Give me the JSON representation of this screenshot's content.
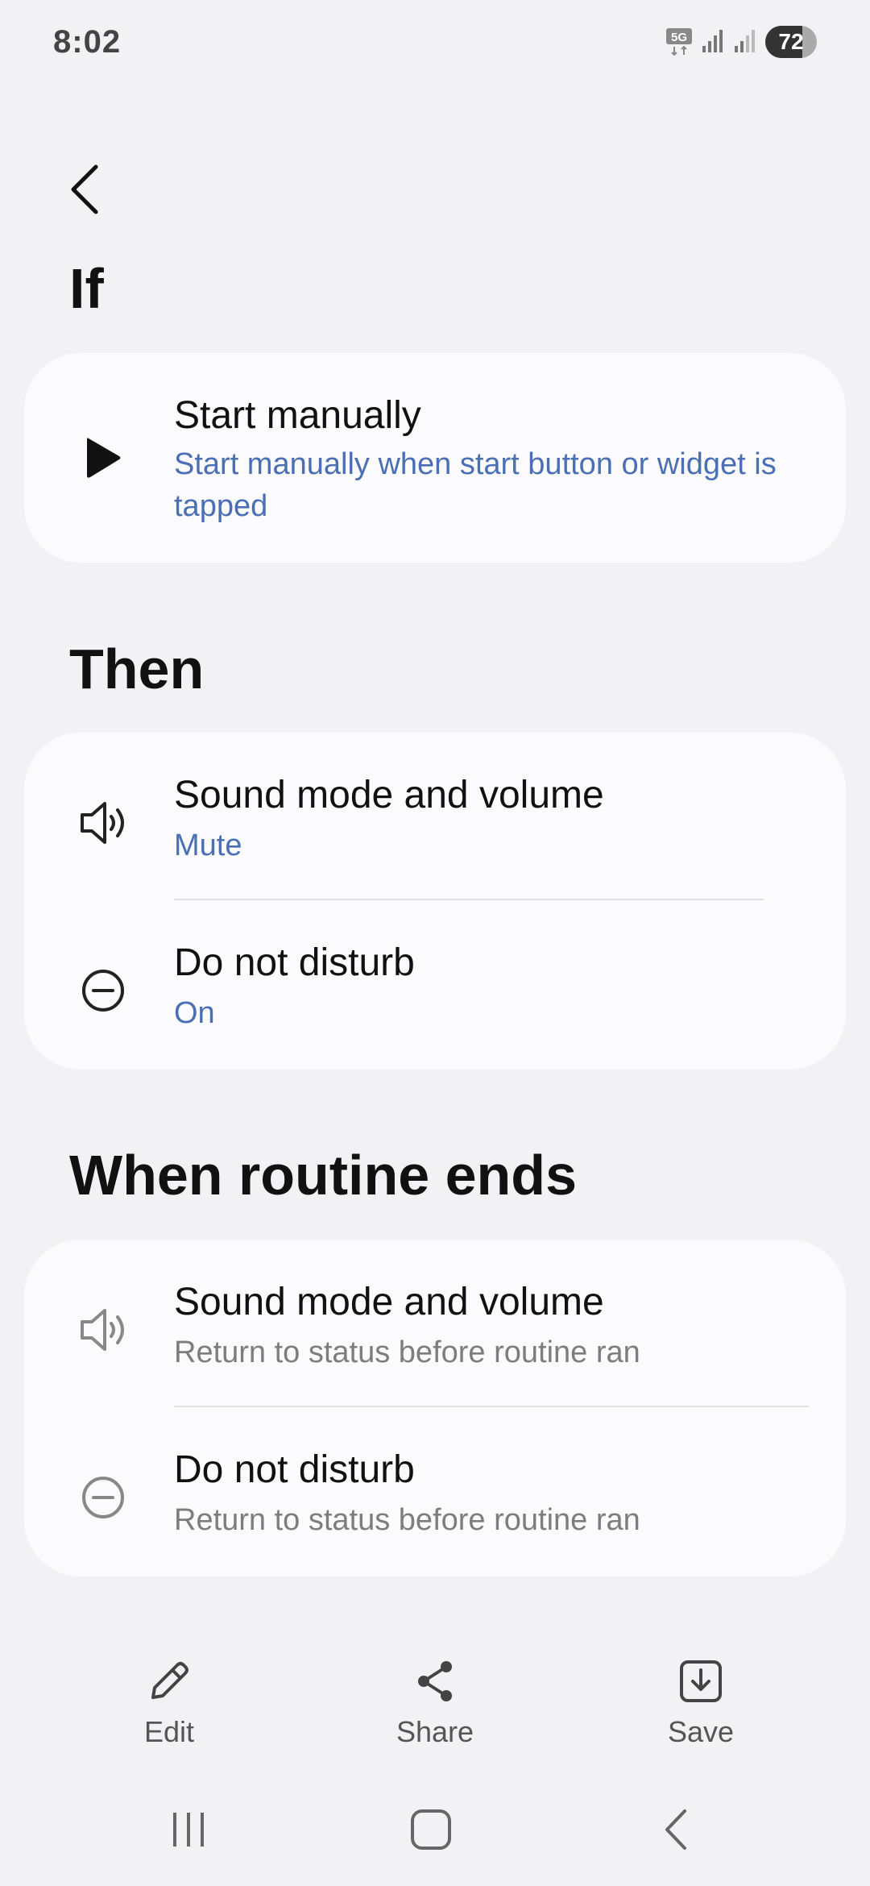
{
  "status_bar": {
    "time": "8:02",
    "network": "5G",
    "battery": "72",
    "battery_level": 0.72
  },
  "header": {
    "back_icon": "chevron-left-icon"
  },
  "if_section": {
    "title": "If",
    "items": [
      {
        "icon": "play-icon",
        "title": "Start manually",
        "subtitle": "Start manually when start button or widget is tapped"
      }
    ]
  },
  "then_section": {
    "title": "Then",
    "items": [
      {
        "icon": "speaker-icon",
        "title": "Sound mode and volume",
        "subtitle": "Mute"
      },
      {
        "icon": "do-not-disturb-icon",
        "title": "Do not disturb",
        "subtitle": "On"
      }
    ]
  },
  "ends_section": {
    "title": "When routine ends",
    "items": [
      {
        "icon": "speaker-icon",
        "title": "Sound mode and volume",
        "subtitle": "Return to status before routine ran"
      },
      {
        "icon": "do-not-disturb-icon",
        "title": "Do not disturb",
        "subtitle": "Return to status before routine ran"
      }
    ]
  },
  "actions": {
    "edit": "Edit",
    "share": "Share",
    "save": "Save"
  },
  "colors": {
    "background": "#f2f2f4",
    "card": "#fbfbfd",
    "accent_subtitle": "#4a6fb4",
    "grey_subtitle": "#7d7d7f"
  }
}
